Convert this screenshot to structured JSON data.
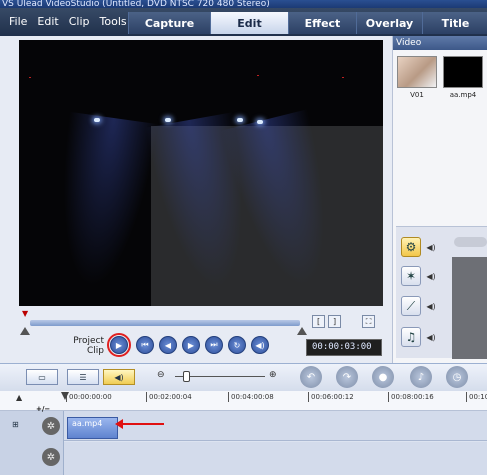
{
  "window": {
    "title": "VS Ulead VideoStudio (Untitled, DVD NTSC 720 480 Stereo)"
  },
  "menu": [
    "File",
    "Edit",
    "Clip",
    "Tools"
  ],
  "steps": [
    {
      "label": "Capture",
      "active": false
    },
    {
      "label": "Edit",
      "active": true
    },
    {
      "label": "Effect",
      "active": false
    },
    {
      "label": "Overlay",
      "active": false
    },
    {
      "label": "Title",
      "active": false
    }
  ],
  "library": {
    "header": "Video",
    "items": [
      {
        "label": "V01"
      },
      {
        "label": "aa.mp4"
      }
    ]
  },
  "playback": {
    "project_label": "Project",
    "clip_label": "Clip",
    "timecode": "00:00:03:00",
    "trim_markers": [
      "[",
      "]"
    ]
  },
  "timeline": {
    "ruler_ticks": [
      "00:00:00:00",
      "00:02:00:04",
      "00:04:00:08",
      "00:06:00:12",
      "00:08:00:16",
      "00:10"
    ],
    "track_toggle": "+/−",
    "clip_label": "aa.mp4"
  },
  "icons": {
    "play": "play-icon",
    "home": "home-icon",
    "prev": "prev-icon",
    "next": "next-icon",
    "end": "end-icon",
    "repeat": "repeat-icon",
    "volume": "volume-icon"
  },
  "colors": {
    "active_step": "#dfe7f5",
    "annotation": "#e01010"
  }
}
